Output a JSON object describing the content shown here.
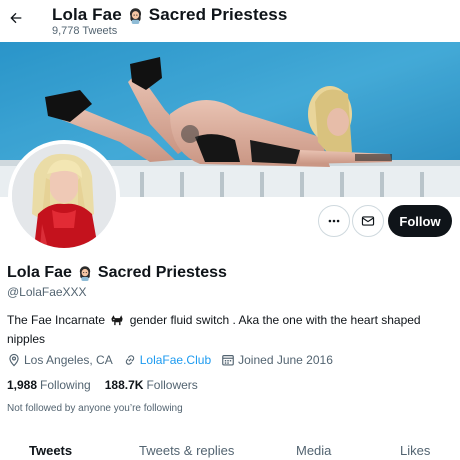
{
  "header": {
    "title_name": "Lola Fae",
    "title_suffix": "Sacred Priestess",
    "tweet_count": "9,778 Tweets"
  },
  "profile": {
    "display_name": "Lola Fae",
    "display_suffix": "Sacred Priestess",
    "handle": "@LolaFaeXXX",
    "bio_part1": "The Fae Incarnate",
    "bio_part2": "gender fluid switch . Aka the one with the heart shaped nipples",
    "location": "Los Angeles, CA",
    "website": "LolaFae.Club",
    "joined": "Joined June 2016",
    "following_count": "1,988",
    "following_label": "Following",
    "followers_count": "188.7K",
    "followers_label": "Followers",
    "followed_note": "Not followed by anyone you’re following"
  },
  "actions": {
    "follow_label": "Follow"
  },
  "tabs": [
    {
      "label": "Tweets"
    },
    {
      "label": "Tweets & replies"
    },
    {
      "label": "Media"
    },
    {
      "label": "Likes"
    }
  ],
  "icons": {
    "back": "back-arrow-icon",
    "more": "more-dots-icon",
    "message": "envelope-icon",
    "location": "location-pin-icon",
    "link": "link-icon",
    "calendar": "calendar-icon",
    "emoji": "fairy-emoji-icon",
    "dog": "dog-emoji-icon"
  },
  "colors": {
    "accent": "#1d9bf0",
    "text_primary": "#0f1419",
    "text_secondary": "#536471",
    "banner_blue": "#3aa8dc"
  }
}
